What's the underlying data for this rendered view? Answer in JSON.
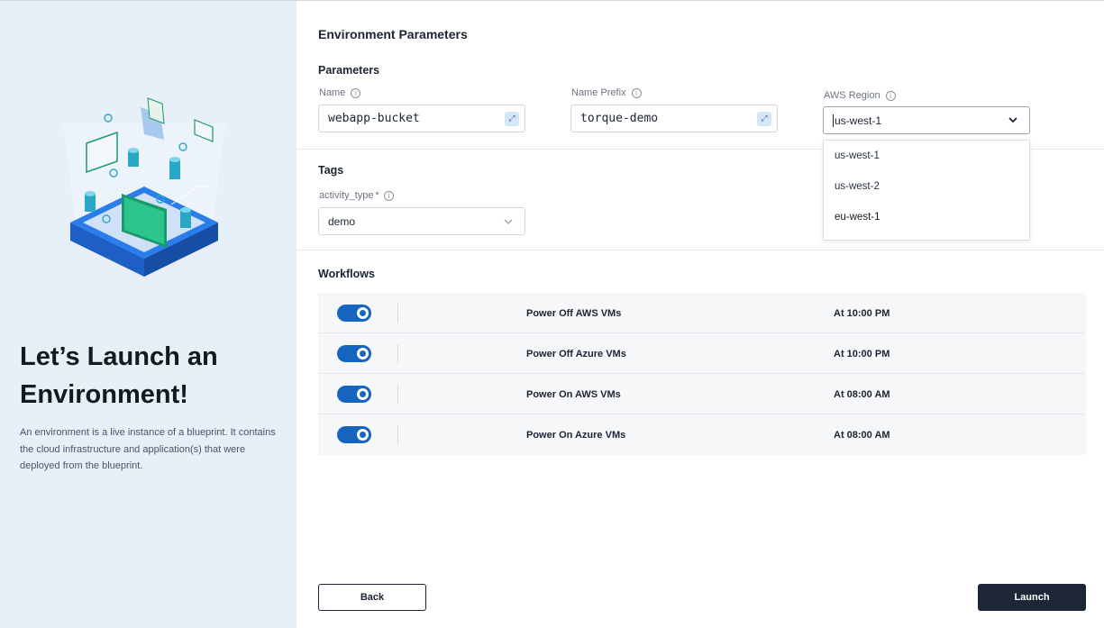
{
  "hero": {
    "title": "Let’s Launch an Environment!",
    "description": "An environment is a live instance of a blueprint. It contains the cloud infrastructure and application(s) that were deployed from the blueprint."
  },
  "page_title": "Environment Parameters",
  "parameters": {
    "section_title": "Parameters",
    "name": {
      "label": "Name",
      "value": "webapp-bucket"
    },
    "name_prefix": {
      "label": "Name Prefix",
      "value": "torque-demo"
    },
    "aws_region": {
      "label": "AWS Region",
      "value": "us-west-1",
      "options": [
        "us-west-1",
        "us-west-2",
        "eu-west-1"
      ]
    }
  },
  "tags": {
    "section_title": "Tags",
    "activity_type": {
      "label": "activity_type",
      "required_mark": "*",
      "value": "demo"
    }
  },
  "workflows": {
    "section_title": "Workflows",
    "rows": [
      {
        "name": "Power Off AWS VMs",
        "schedule": "At 10:00 PM",
        "enabled": true
      },
      {
        "name": "Power Off Azure VMs",
        "schedule": "At 10:00 PM",
        "enabled": true
      },
      {
        "name": "Power On AWS VMs",
        "schedule": "At 08:00 AM",
        "enabled": true
      },
      {
        "name": "Power On Azure VMs",
        "schedule": "At 08:00 AM",
        "enabled": true
      }
    ]
  },
  "buttons": {
    "back": "Back",
    "launch": "Launch"
  },
  "icons": {
    "info": "info-icon",
    "expand": "expand-icon",
    "chevron": "chevron-down-icon",
    "toggle": "toggle-switch"
  },
  "colors": {
    "accent": "#1565c0",
    "primary_button": "#1c2637",
    "left_panel": "#e7eff8"
  }
}
